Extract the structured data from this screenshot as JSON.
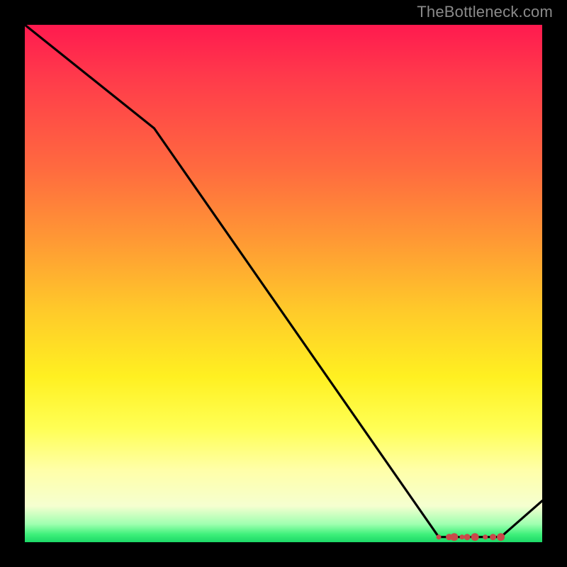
{
  "watermark": "TheBottleneck.com",
  "chart_data": {
    "type": "line",
    "title": "",
    "xlabel": "",
    "ylabel": "",
    "xlim": [
      0,
      100
    ],
    "ylim": [
      0,
      100
    ],
    "series": [
      {
        "name": "bottleneck-curve",
        "x": [
          0,
          25,
          80,
          88,
          92,
          100
        ],
        "values": [
          100,
          80,
          1,
          1,
          1,
          8
        ]
      }
    ],
    "markers": {
      "name": "optimal-cluster",
      "color": "#c94a4a",
      "x": [
        80,
        82,
        83,
        84.5,
        85.5,
        87,
        89,
        90.5,
        92
      ],
      "values": [
        1,
        1,
        1,
        1,
        1,
        1,
        1,
        1,
        1
      ]
    },
    "gradient_stops": [
      {
        "pos": 0,
        "color": "#ff1a4f"
      },
      {
        "pos": 0.1,
        "color": "#ff3a4b"
      },
      {
        "pos": 0.28,
        "color": "#ff6b3f"
      },
      {
        "pos": 0.42,
        "color": "#ff9a34"
      },
      {
        "pos": 0.55,
        "color": "#ffc92a"
      },
      {
        "pos": 0.68,
        "color": "#fff021"
      },
      {
        "pos": 0.78,
        "color": "#ffff55"
      },
      {
        "pos": 0.86,
        "color": "#ffffa8"
      },
      {
        "pos": 0.93,
        "color": "#f5ffd0"
      },
      {
        "pos": 0.965,
        "color": "#9fffb0"
      },
      {
        "pos": 0.985,
        "color": "#3df07a"
      },
      {
        "pos": 1.0,
        "color": "#1cd867"
      }
    ]
  }
}
